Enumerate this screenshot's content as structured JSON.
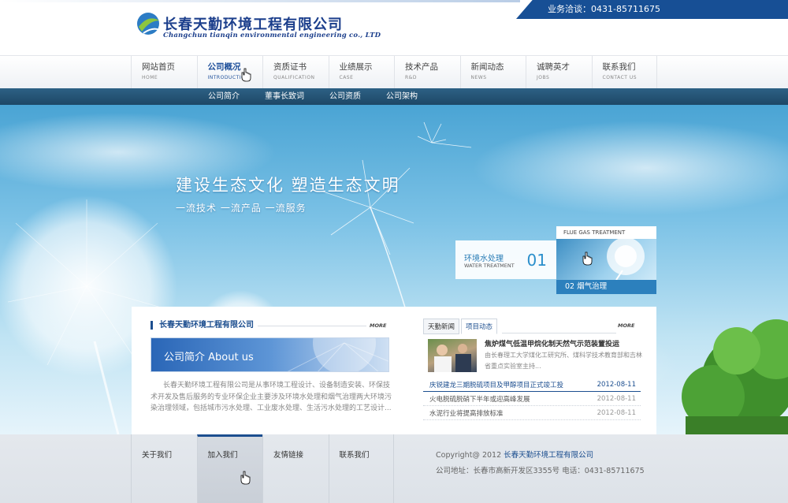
{
  "header": {
    "logo_cn": "长春天勤环境工程有限公司",
    "logo_en": "Changchun tianqin environmental engineering co., LTD",
    "hotline": "业务洽谈：0431-85711675"
  },
  "nav": {
    "items": [
      {
        "cn": "网站首页",
        "en": "HOME"
      },
      {
        "cn": "公司概况",
        "en": "INTRODUCTION"
      },
      {
        "cn": "资质证书",
        "en": "QUALIFICATION"
      },
      {
        "cn": "业绩展示",
        "en": "CASE"
      },
      {
        "cn": "技术产品",
        "en": "R&D"
      },
      {
        "cn": "新闻动态",
        "en": "NEWS"
      },
      {
        "cn": "诚聘英才",
        "en": "JOBS"
      },
      {
        "cn": "联系我们",
        "en": "CONTACT US"
      }
    ],
    "active_index": 1
  },
  "subnav": [
    "公司简介",
    "董事长致词",
    "公司资质",
    "公司架构"
  ],
  "banner": {
    "slogan": "建设生态文化   塑造生态文明",
    "sub": "一流技术 一流产品 一流服务",
    "switch_left": {
      "cn": "环境水处理",
      "en": "WATER TREATMENT",
      "num": "01"
    },
    "switch_right": {
      "title": "FLUE GAS TREATMENT",
      "caption": "02 烟气治理"
    }
  },
  "about": {
    "title": "长春天勤环境工程有限公司",
    "more": "MORE",
    "image_text": "公司简介  About us",
    "text": "长春天勤环境工程有限公司是从事环境工程设计、设备制造安装、环保技术开发及售后服务的专业环保企业主要涉及环境水处理和烟气治理两大环境污染治理领域，包括城市污水处理、工业废水处理、生活污水处理的工艺设计..."
  },
  "news": {
    "tabs": [
      "天勤新闻",
      "项目动态"
    ],
    "active_tab": 1,
    "more": "MORE",
    "featured_title": "焦炉煤气低温甲烷化制天然气示范装置投运",
    "featured_desc": "由长春理工大学煤化工研究所、煤科学技术教育部和吉林省重点实验室主持...",
    "rows": [
      {
        "text": "庆锐建龙三期脱硫项目及甲醇项目正式竣工投",
        "date": "2012-08-11",
        "hl": true
      },
      {
        "text": "火电脱硫脱硝下半年或迎高峰发展",
        "date": "2012-08-11"
      },
      {
        "text": "水泥行业将提高排放标准",
        "date": "2012-08-11"
      }
    ]
  },
  "footer": {
    "links": [
      "关于我们",
      "加入我们",
      "友情链接",
      "联系我们"
    ],
    "active_index": 1,
    "copyright_prefix": "Copyright@ 2012 ",
    "copyright_company": "长春天勤环境工程有限公司",
    "address": "公司地址：长春市高新开发区3355号      电话：0431-85711675"
  },
  "colors": {
    "brand": "#1c4e8f",
    "accent": "#2c80bd",
    "hotline_bg": "#174f95"
  }
}
